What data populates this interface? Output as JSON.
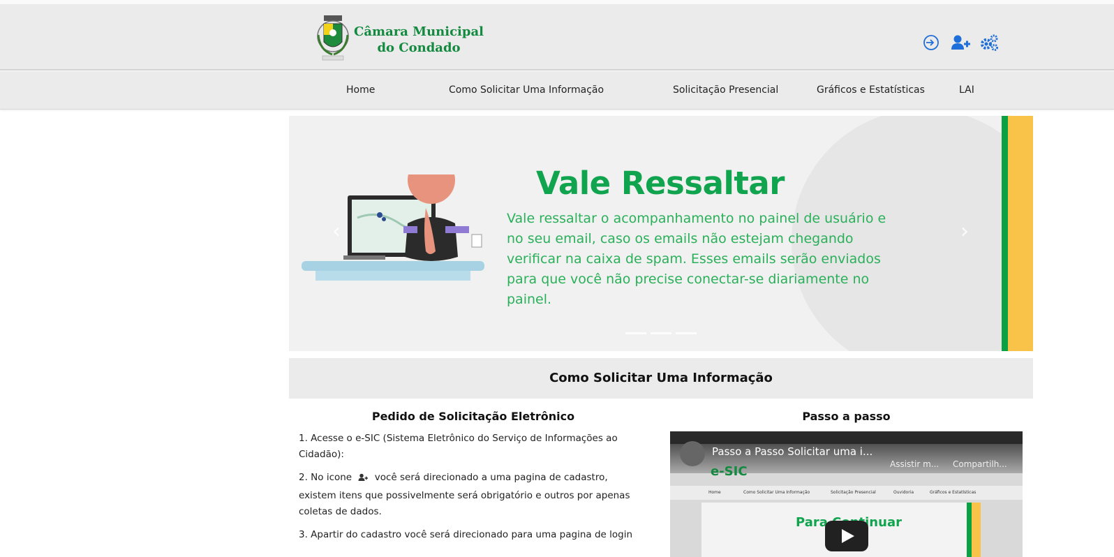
{
  "header": {
    "brand_line1": "Câmara Municipal",
    "brand_line2": "do Condado",
    "icons": [
      "sign-in-icon",
      "user-plus-icon",
      "cogs-icon"
    ],
    "accent_color": "#138a3f"
  },
  "nav": {
    "items": [
      {
        "label": "Home"
      },
      {
        "label": "Como Solicitar Uma Informação"
      },
      {
        "label": "Solicitação Presencial"
      },
      {
        "label": "Gráficos e Estatísticas"
      },
      {
        "label": "LAI"
      }
    ]
  },
  "banner": {
    "title": "Vale Ressaltar",
    "text": "Vale ressaltar o acompanhamento no painel de usuário e no seu email, caso os emails não estejam chegando verificar na caixa de spam. Esses emails serão enviados para que você não precise conectar-se diariamente no painel.",
    "colors": {
      "green": "#0aa142",
      "yellow": "#f9c248",
      "title": "#11a44f"
    }
  },
  "section": {
    "title": "Como Solicitar Uma Informação"
  },
  "left": {
    "title": "Pedido de Solicitação Eletrônico",
    "p1": "1. Acesse o e-SIC (Sistema Eletrônico do Serviço de Informações ao Cidadão):",
    "p2_before": "2. No icone",
    "p2_after": "você será direcionado a uma pagina de cadastro, existem itens que possivelmente será obrigatório e outros por apenas coletas de dados.",
    "p3": "3. Apartir do cadastro você será direcionado para uma pagina de login"
  },
  "right": {
    "title": "Passo a passo",
    "video": {
      "title": "Passo a Passo Solicitar uma i...",
      "watch_later": "Assistir m...",
      "share": "Compartilh...",
      "esic": "e-SIC",
      "continue": "Para Continuar",
      "mini_nav": [
        "Home",
        "Como Solicitar Uma Informação",
        "Solicitação Presencial",
        "Ouvidoria",
        "Gráficos e Estatísticas"
      ]
    }
  }
}
